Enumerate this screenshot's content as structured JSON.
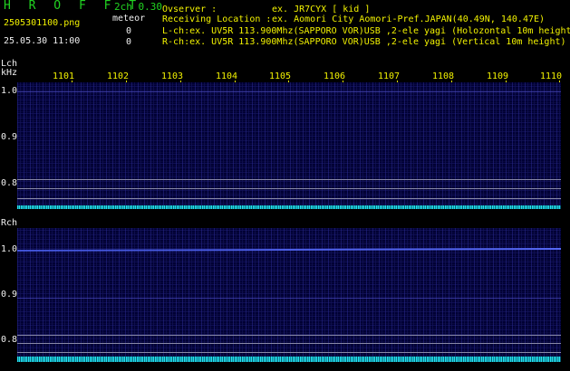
{
  "header": {
    "brand": "H R O F F T",
    "mode": "2ch 0.30",
    "filename": "2505301100.png",
    "meteor_label": "meteor",
    "meteor_lch_count": "0",
    "meteor_rch_count": "0",
    "datetime": "25.05.30 11:00"
  },
  "info": {
    "observer_label": "Ovserver           :",
    "observer_value": "ex. JR7CYX [ kid ]",
    "location_label": "Receiving Location :",
    "location_value": "ex. Aomori City Aomori-Pref.JAPAN(40.49N, 140.47E)",
    "lch_line": "L-ch:ex. UV5R 113.900Mhz(SAPPORO VOR)USB ,2-ele yagi (Holozontal 10m height)",
    "rch_line": "R-ch:ex. UV5R 113.900Mhz(SAPPORO VOR)USB ,2-ele yagi (Vertical 10m height)"
  },
  "spectrogram": {
    "lch_label": "Lch",
    "rch_label": "Rch",
    "unit_label": "kHz",
    "time_ticks": [
      "1101",
      "1102",
      "1103",
      "1104",
      "1105",
      "1106",
      "1107",
      "1108",
      "1109",
      "1110"
    ],
    "freq_ticks_lch": [
      "1.0",
      "0.9",
      "0.8"
    ],
    "freq_ticks_rch": [
      "1.0",
      "0.9",
      "0.8"
    ]
  },
  "colors": {
    "brand_green": "#21d321",
    "label_yellow": "#f2f200",
    "background_navy": "#000034",
    "floor_cyan": "#27e5f0"
  }
}
